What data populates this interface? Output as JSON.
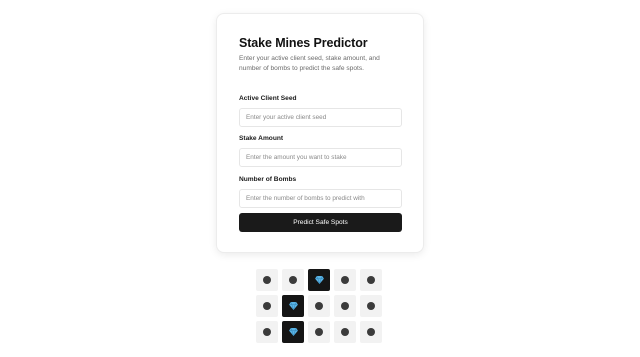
{
  "app": {
    "title": "Stake Mines Predictor",
    "subtitle": "Enter your active client seed, stake amount, and number of bombs to predict the safe spots."
  },
  "form": {
    "client_seed": {
      "label": "Active Client Seed",
      "placeholder": "Enter your active client seed",
      "value": ""
    },
    "stake_amount": {
      "label": "Stake Amount",
      "placeholder": "Enter the amount you want to stake",
      "value": ""
    },
    "bombs": {
      "label": "Number of Bombs",
      "placeholder": "Enter the number of bombs to predict with",
      "value": ""
    },
    "submit_label": "Predict Safe Spots"
  },
  "grid": {
    "columns": 5,
    "tiles": [
      [
        "dot",
        "dot",
        "gem",
        "dot",
        "dot"
      ],
      [
        "dot",
        "gem",
        "dot",
        "dot",
        "dot"
      ],
      [
        "dot",
        "gem",
        "dot",
        "dot",
        "dot"
      ]
    ],
    "icons": {
      "unknown": "dot-icon",
      "safe": "diamond-gem-icon"
    },
    "colors": {
      "gem": "#5ab4e6",
      "safe_tile": "#151515",
      "tile": "#f2f2f2",
      "dot": "#3b3b3b"
    }
  }
}
